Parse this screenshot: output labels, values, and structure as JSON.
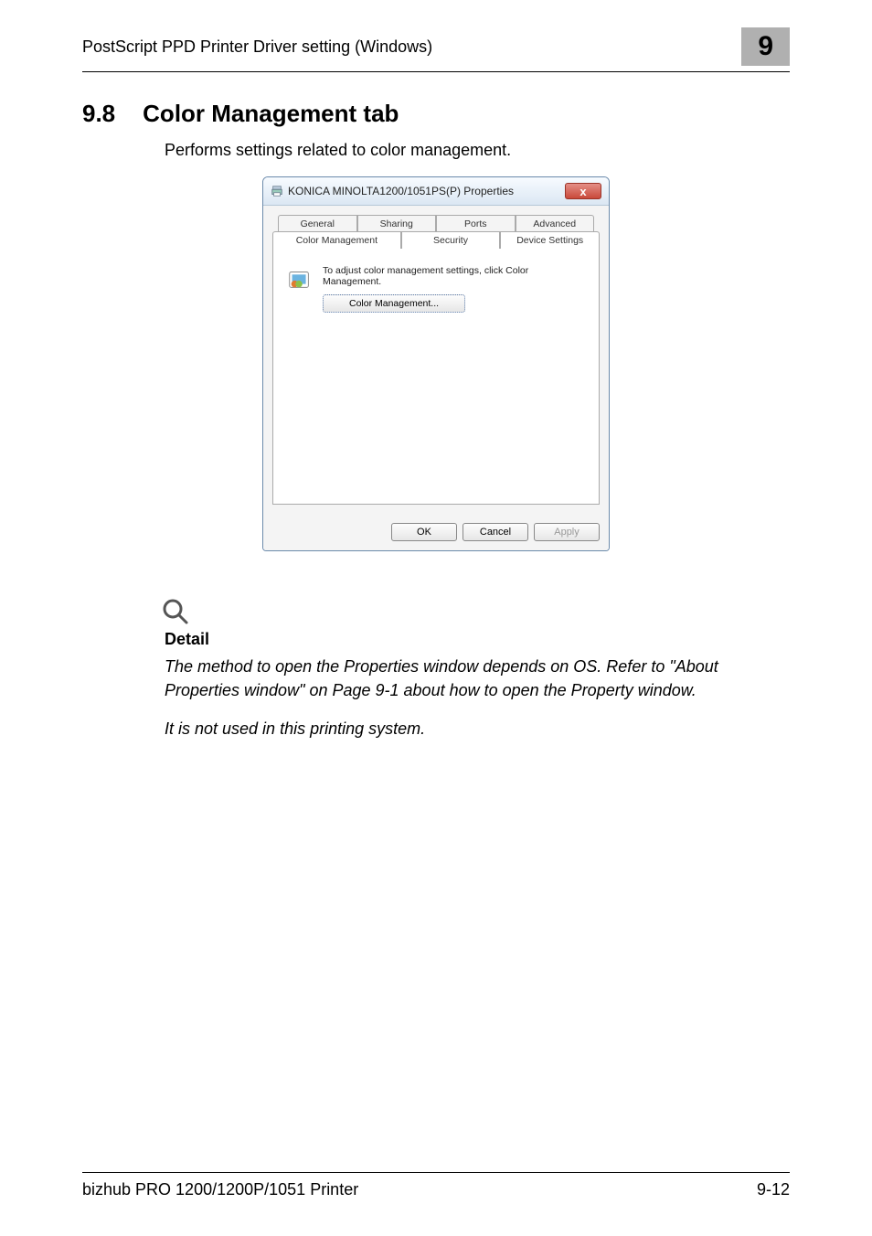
{
  "header": {
    "breadcrumb": "PostScript PPD Printer Driver setting (Windows)",
    "chapter": "9"
  },
  "section": {
    "number": "9.8",
    "title": "Color Management tab",
    "description": "Performs settings related to color management."
  },
  "dialog": {
    "title": "KONICA MINOLTA1200/1051PS(P) Properties",
    "close_glyph": "x",
    "tabs_back": [
      "General",
      "Sharing",
      "Ports",
      "Advanced"
    ],
    "tabs_front": [
      "Color Management",
      "Security",
      "Device Settings"
    ],
    "active_tab": "Color Management",
    "instruction": "To adjust color management settings, click Color Management.",
    "cm_button": "Color Management...",
    "buttons": {
      "ok": "OK",
      "cancel": "Cancel",
      "apply": "Apply"
    }
  },
  "detail": {
    "heading": "Detail",
    "paragraph1": "The method to open the Properties window depends on OS. Refer to \"About Properties window\" on Page 9-1 about how to open the Property window.",
    "paragraph2": "It is not used in this printing system."
  },
  "footer": {
    "product": "bizhub PRO 1200/1200P/1051 Printer",
    "page": "9-12"
  }
}
